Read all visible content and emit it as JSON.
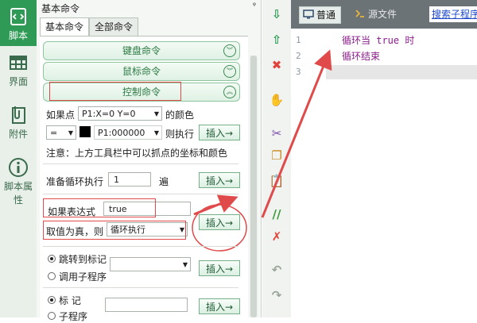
{
  "sidebar": {
    "items": [
      {
        "label": "脚本",
        "icon": "script-icon",
        "active": true
      },
      {
        "label": "界面",
        "icon": "layout-grid-icon",
        "active": false
      },
      {
        "label": "附件",
        "icon": "attachment-icon",
        "active": false
      },
      {
        "label": "脚本属性",
        "icon": "info-icon",
        "active": false
      }
    ]
  },
  "panel": {
    "title": "基本命令",
    "pin": "ᵠ",
    "tabs": [
      "基本命令",
      "全部命令"
    ],
    "categories": [
      "键盘命令",
      "鼠标命令",
      "控制命令"
    ],
    "if_point": {
      "prefix": "如果点",
      "point_value": "P1:X=0 Y=0",
      "suffix": "的颜色",
      "operator": "=",
      "color_value": "P1:000000",
      "then_label": "则执行",
      "insert": "插入→"
    },
    "note": "注意：上方工具栏中可以抓点的坐标和颜色",
    "loop": {
      "label": "准备循环执行",
      "value": "1",
      "unit": "遍",
      "insert": "插入→"
    },
    "if_expr": {
      "label": "如果表达式",
      "value": "true",
      "true_label": "取值为真，则",
      "action": "循环执行",
      "insert": "插入→"
    },
    "jump": {
      "option1": "跳转到标记",
      "option2": "调用子程序",
      "insert": "插入→"
    },
    "mark": {
      "option1": "标 记",
      "option2": "子程序",
      "insert": "插入→"
    }
  },
  "toolbar": {
    "icons": [
      {
        "name": "move-down-icon",
        "glyph": "⇩",
        "color": "#2f9a56"
      },
      {
        "name": "move-up-icon",
        "glyph": "⇧",
        "color": "#2f9a56"
      },
      {
        "name": "delete-icon",
        "glyph": "✖",
        "color": "#e0443a"
      },
      {
        "name": "hand-icon",
        "glyph": "✋",
        "color": "#c8891e"
      },
      {
        "name": "cut-icon",
        "glyph": "✂",
        "color": "#7a4aa8"
      },
      {
        "name": "copy-icon",
        "glyph": "❐",
        "color": "#c8891e"
      },
      {
        "name": "paste-icon",
        "glyph": "📋",
        "color": "#c8891e"
      },
      {
        "name": "comment-icon",
        "glyph": "//",
        "color": "#3a9a3a"
      },
      {
        "name": "uncomment-icon",
        "glyph": "✗",
        "color": "#e0443a"
      },
      {
        "name": "undo-icon",
        "glyph": "↶",
        "color": "#9aa59a"
      },
      {
        "name": "redo-icon",
        "glyph": "↷",
        "color": "#9aa59a"
      }
    ]
  },
  "editor": {
    "tabs": [
      {
        "label": "普通",
        "icon": "monitor-icon",
        "active": true
      },
      {
        "label": "源文件",
        "icon": "source-file-icon",
        "active": false
      }
    ],
    "search_link": "搜索子程序",
    "lines": [
      {
        "number": "1",
        "text": "循环当 true 时"
      },
      {
        "number": "2",
        "text": "循环结束"
      },
      {
        "number": "3",
        "text": ""
      }
    ]
  },
  "colors": {
    "accent": "#2f9a56",
    "annotation": "#e04a4a",
    "code": "#8a1c8a"
  }
}
